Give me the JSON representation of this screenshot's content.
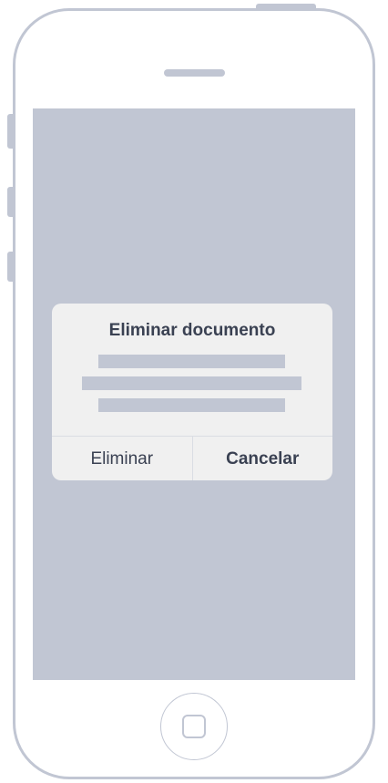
{
  "dialog": {
    "title": "Eliminar documento",
    "delete_label": "Eliminar",
    "cancel_label": "Cancelar"
  },
  "colors": {
    "screen": "#c1c6d3",
    "dialog_background": "#f0f0f0",
    "text": "#3a4152",
    "phone_outline": "#c1c6d3"
  },
  "icons": {
    "home_button": "home-button-icon",
    "speaker": "speaker-icon"
  }
}
